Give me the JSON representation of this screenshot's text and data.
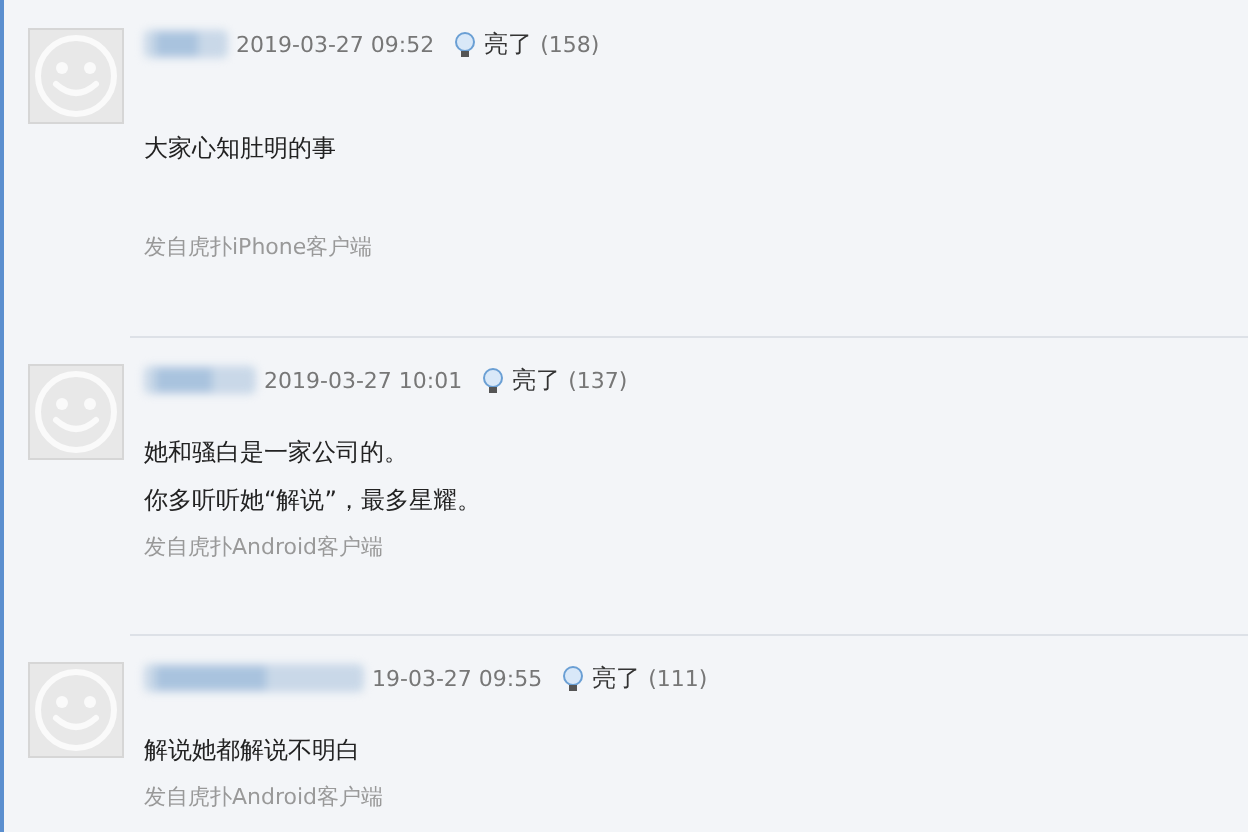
{
  "comments": [
    {
      "time": "2019-03-27 09:52",
      "light_label": "亮了",
      "light_count": "(158)",
      "lines": [
        "大家心知肚明的事"
      ],
      "source": "发自虎扑iPhone客户端"
    },
    {
      "time": "2019-03-27 10:01",
      "light_label": "亮了",
      "light_count": "(137)",
      "lines": [
        "她和骚白是一家公司的。",
        "你多听听她“解说”，最多星耀。"
      ],
      "source": "发自虎扑Android客户端"
    },
    {
      "time": "19-03-27 09:55",
      "light_label": "亮了",
      "light_count": "(111)",
      "lines": [
        "解说她都解说不明白"
      ],
      "source": "发自虎扑Android客户端"
    }
  ]
}
